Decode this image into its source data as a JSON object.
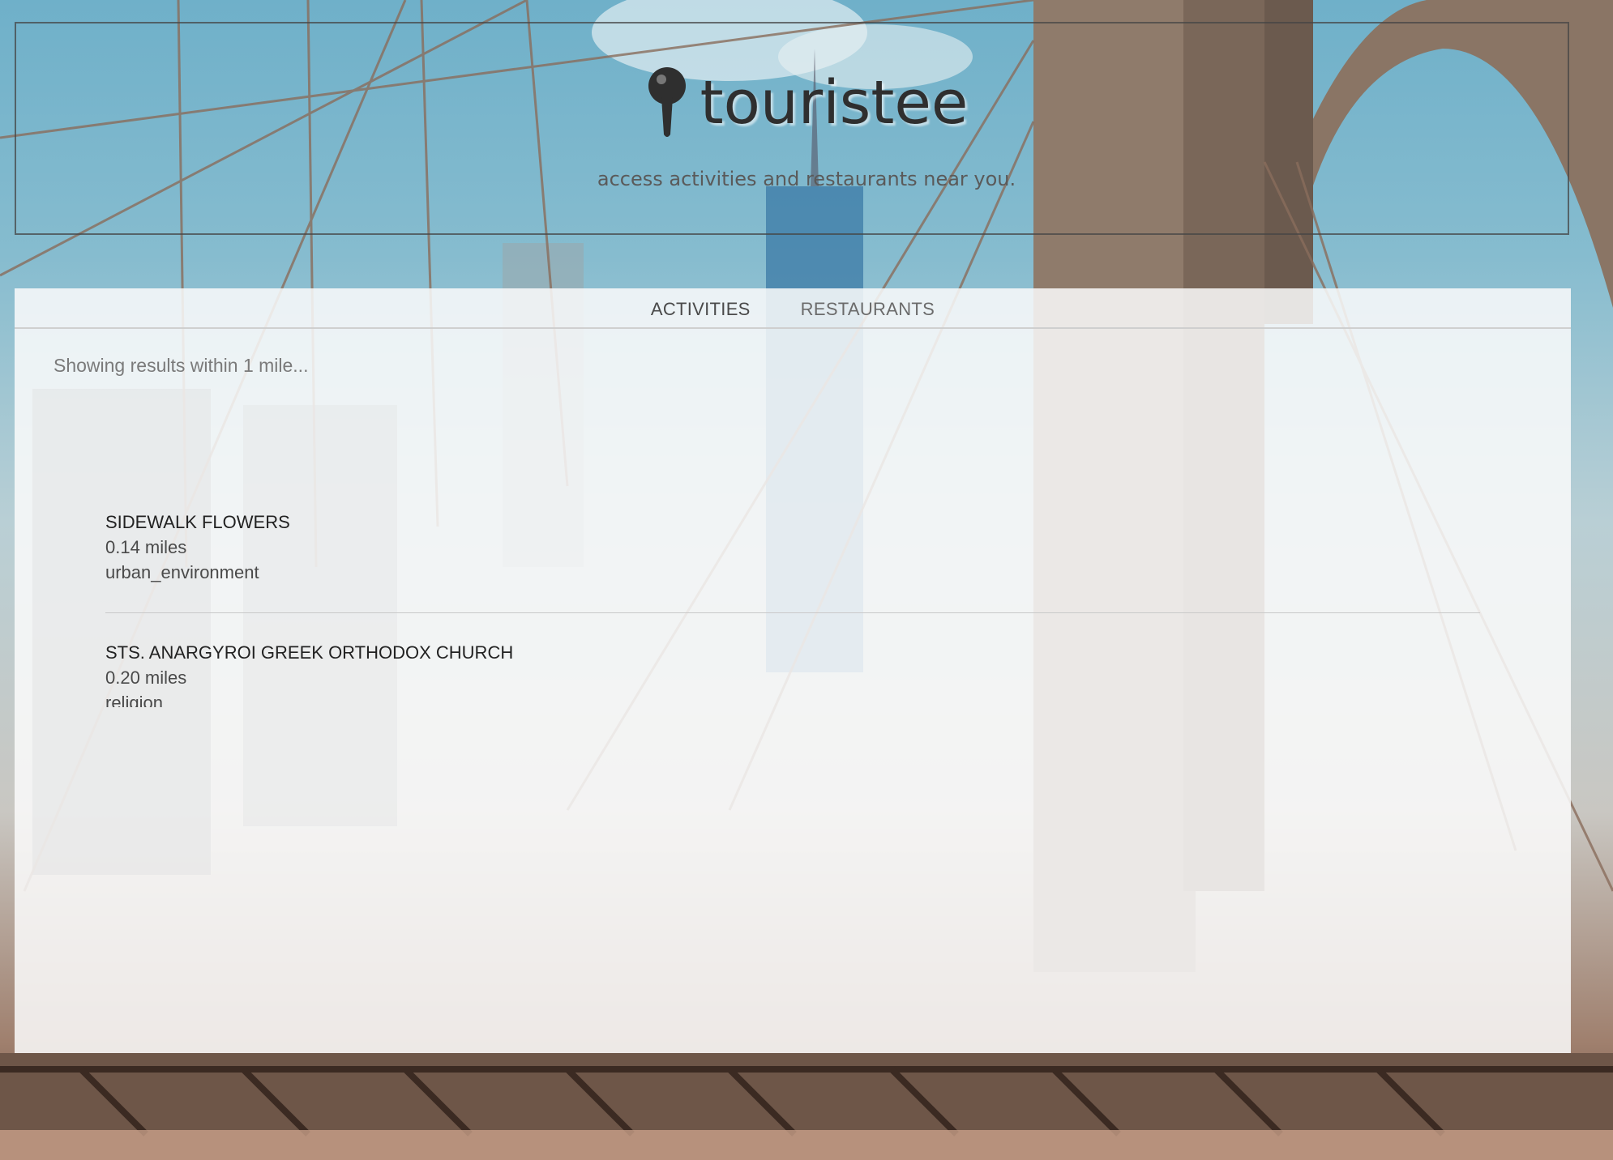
{
  "app": {
    "brand": "touristee",
    "tagline": "access activities and restaurants near you."
  },
  "tabs": [
    {
      "label": "ACTIVITIES",
      "active": true
    },
    {
      "label": "RESTAURANTS",
      "active": false
    }
  ],
  "status": "Showing results within 1 mile...",
  "results": [
    {
      "name": "SIDEWALK FLOWERS",
      "distance": "0.14 miles",
      "category": "urban_environment"
    },
    {
      "name": "STS. ANARGYROI GREEK ORTHODOX CHURCH",
      "distance": "0.20 miles",
      "category": "religion"
    }
  ],
  "icons": {
    "logo": "map-pin-icon"
  },
  "colors": {
    "text_dark": "#2f2f2f",
    "panel_bg": "#fafafa",
    "sky": "#6fb0c9"
  }
}
